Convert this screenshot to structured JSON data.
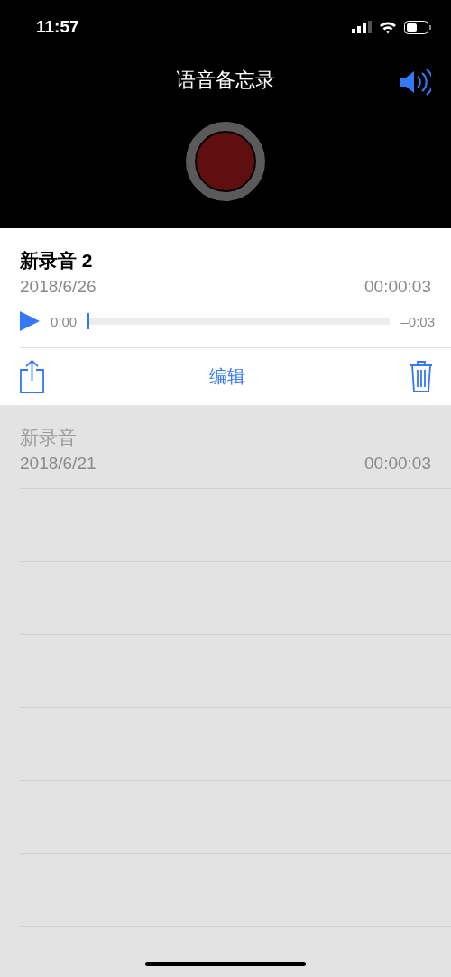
{
  "status_bar": {
    "time": "11:57"
  },
  "header": {
    "title": "语音备忘录"
  },
  "recordings": [
    {
      "name": "新录音 2",
      "date": "2018/6/26",
      "duration": "00:00:03",
      "expanded": true,
      "elapsed": "0:00",
      "remaining": "–0:03",
      "level": 0,
      "edit_label": "编辑"
    },
    {
      "name": "新录音",
      "date": "2018/6/21",
      "duration": "00:00:03",
      "expanded": false
    }
  ]
}
